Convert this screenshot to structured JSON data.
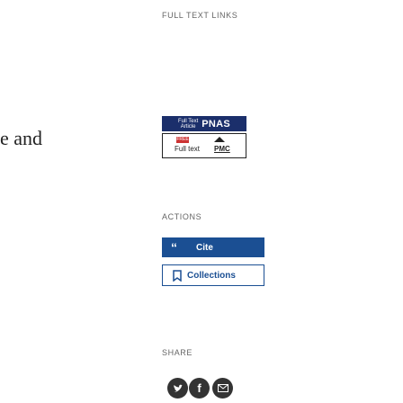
{
  "main": {
    "title_fragment": "e and"
  },
  "sidebar": {
    "full_text_heading": "FULL TEXT LINKS",
    "pnas_link": {
      "fulltext_label": "Full Text\nArticle",
      "brand": "PNAS"
    },
    "pmc_link": {
      "free_badge": "FREE",
      "fulltext_label": "Full text",
      "brand": "PMC"
    },
    "actions_heading": "ACTIONS",
    "cite_button": {
      "icon": "quote-icon",
      "label": "Cite"
    },
    "collections_button": {
      "icon": "bookmark-icon",
      "label": "Collections"
    },
    "share_heading": "SHARE",
    "share_buttons": [
      {
        "name": "share-twitter",
        "icon": "twitter-icon"
      },
      {
        "name": "share-facebook",
        "icon": "facebook-icon"
      },
      {
        "name": "share-email",
        "icon": "email-icon"
      }
    ]
  },
  "colors": {
    "navy": "#1b2f6b",
    "button_blue": "#1b4f93",
    "free_red": "#cc3333"
  }
}
